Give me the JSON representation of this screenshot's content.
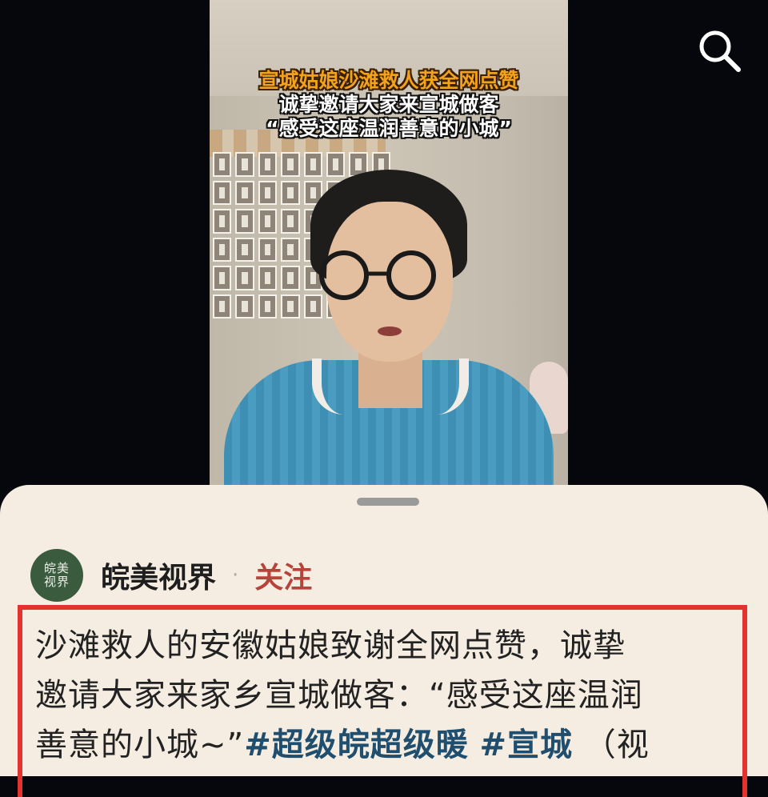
{
  "video": {
    "caption_lines": [
      "宣城姑娘沙滩救人获全网点赞",
      "诚挚邀请大家来宣城做客",
      "“感受这座温润善意的小城”"
    ]
  },
  "toolbar": {
    "search_icon": "search-icon"
  },
  "post": {
    "author": {
      "avatar_text_line1": "皖美",
      "avatar_text_line2": "视界",
      "name": "皖美视界",
      "separator": "·",
      "follow_label": "关注"
    },
    "text_line1": "沙滩救人的安徽姑娘致谢全网点赞，诚挚",
    "text_line2": "邀请大家来家乡宣城做客：“感受这座温润",
    "text_line3_plain": "善意的小城~”",
    "hashtags": [
      "#超级皖超级暖",
      "#宣城"
    ],
    "text_line3_tail": "（视"
  },
  "colors": {
    "background": "#05070c",
    "sheet": "#f6ede2",
    "highlight_border": "#e2332f",
    "follow": "#b7433a",
    "hashtag": "#1f4e6e",
    "caption_orange": "#f3a21c"
  }
}
